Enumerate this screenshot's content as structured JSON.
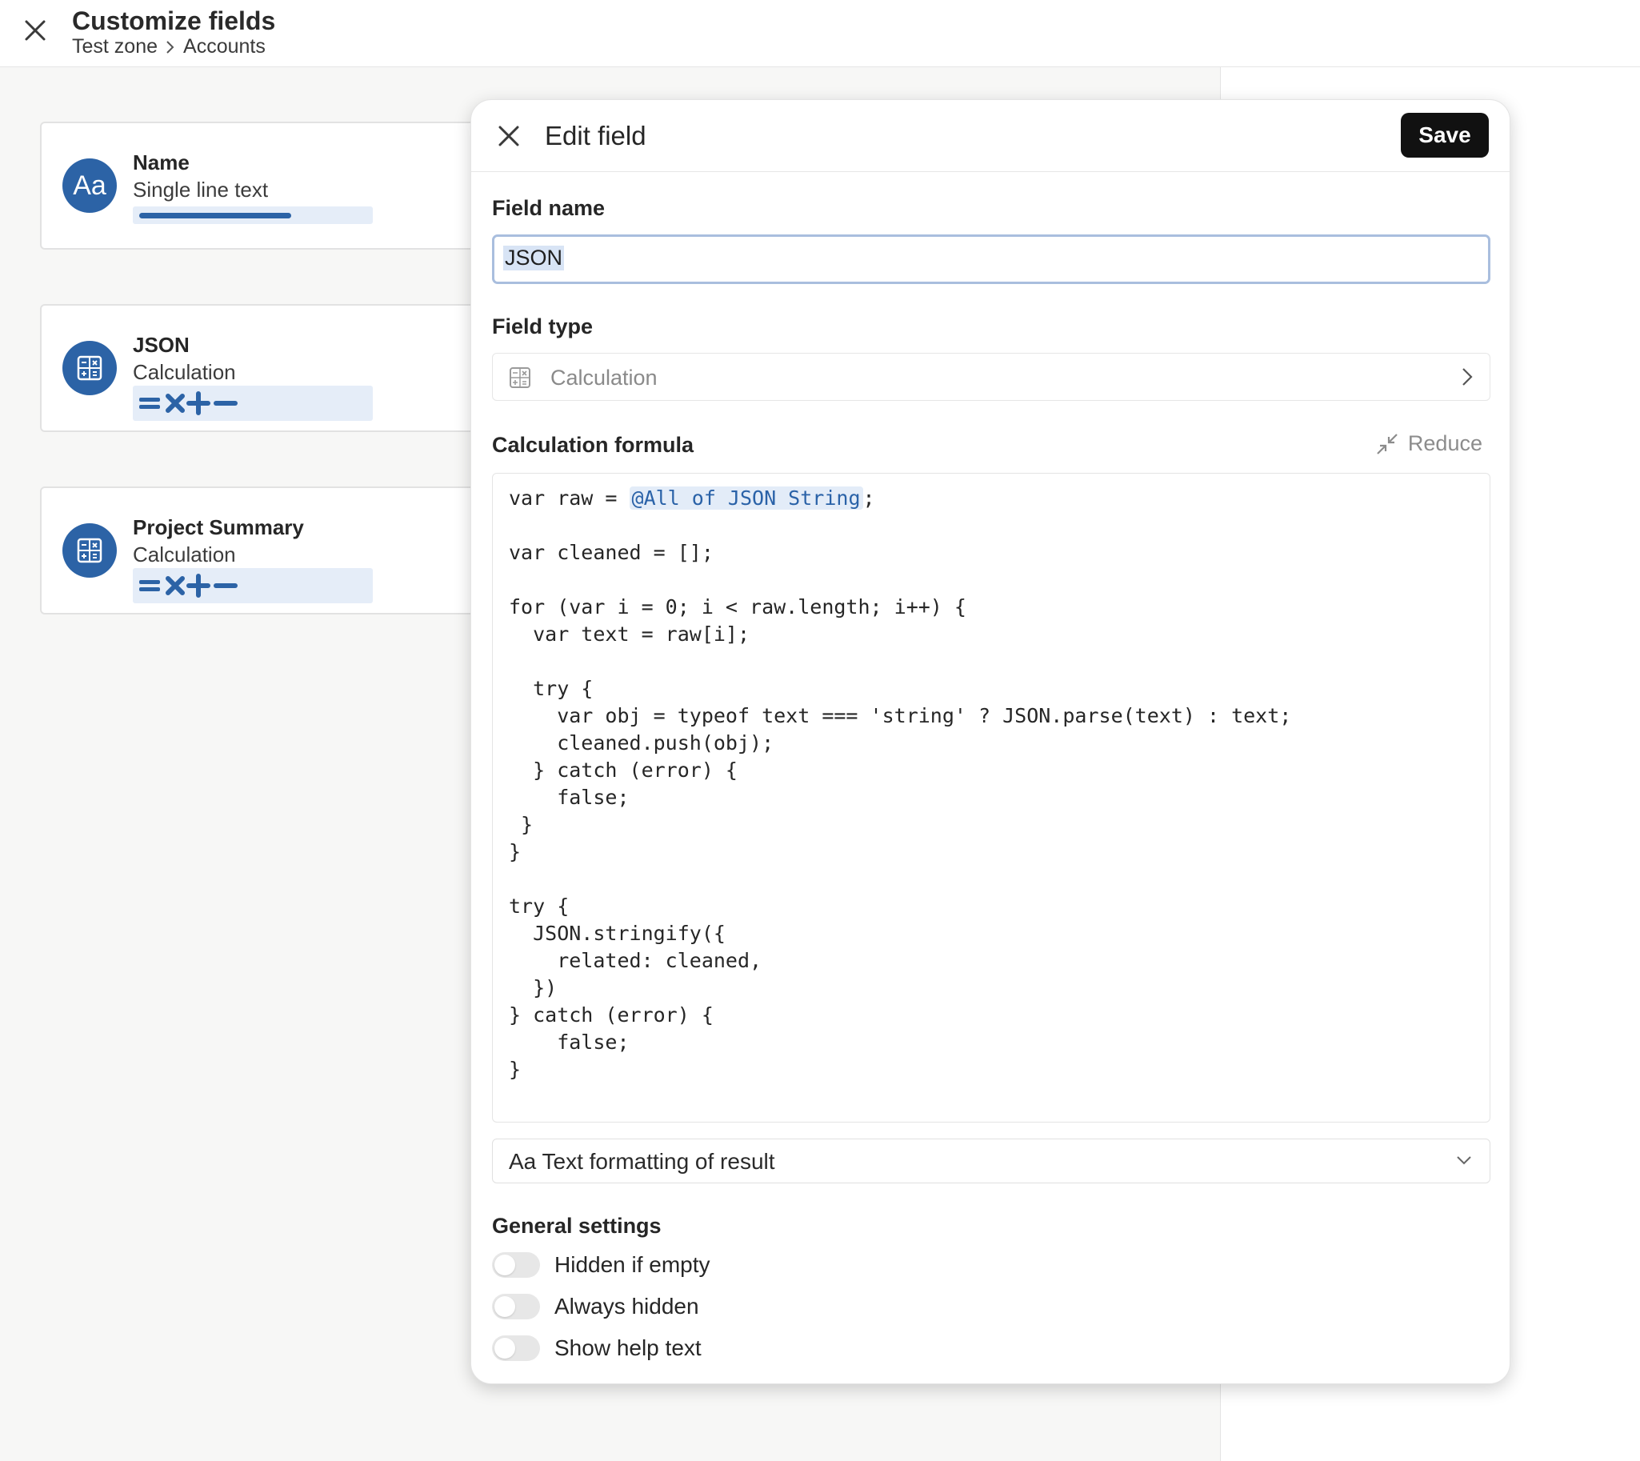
{
  "header": {
    "title": "Customize fields",
    "breadcrumb": [
      "Test zone",
      "Accounts"
    ]
  },
  "fields": [
    {
      "name": "Name",
      "type": "Single line text",
      "icon": "text-aa-icon",
      "avatar_text": "Aa"
    },
    {
      "name": "JSON",
      "type": "Calculation",
      "icon": "calculator-icon"
    },
    {
      "name": "Project Summary",
      "type": "Calculation",
      "icon": "calculator-icon"
    }
  ],
  "modal": {
    "title": "Edit field",
    "save_label": "Save",
    "field_name_label": "Field name",
    "field_name_value": "JSON",
    "field_type_label": "Field type",
    "field_type_value": "Calculation",
    "formula_label": "Calculation formula",
    "reduce_label": "Reduce",
    "formula_reference": "@All of JSON String",
    "code_lines": [
      "var raw = @All of JSON String;",
      "",
      "var cleaned = [];",
      "",
      "for (var i = 0; i < raw.length; i++) {",
      "  var text = raw[i];",
      "",
      "  try {",
      "    var obj = typeof text === 'string' ? JSON.parse(text) : text;",
      "    cleaned.push(obj);",
      "  } catch (error) {",
      "    false;",
      " }",
      "}",
      "",
      "try {",
      "  JSON.stringify({",
      "    related: cleaned,",
      "  })",
      "} catch (error) {",
      "    false;",
      "}"
    ],
    "format_label": "Aa Text formatting of result",
    "general_settings_label": "General settings",
    "toggles": [
      {
        "label": "Hidden if empty",
        "on": false
      },
      {
        "label": "Always hidden",
        "on": false
      },
      {
        "label": "Show help text",
        "on": false
      }
    ]
  },
  "colors": {
    "accent": "#2c63a6",
    "save_button": "#111111",
    "reference_token": "#2a62a8"
  }
}
